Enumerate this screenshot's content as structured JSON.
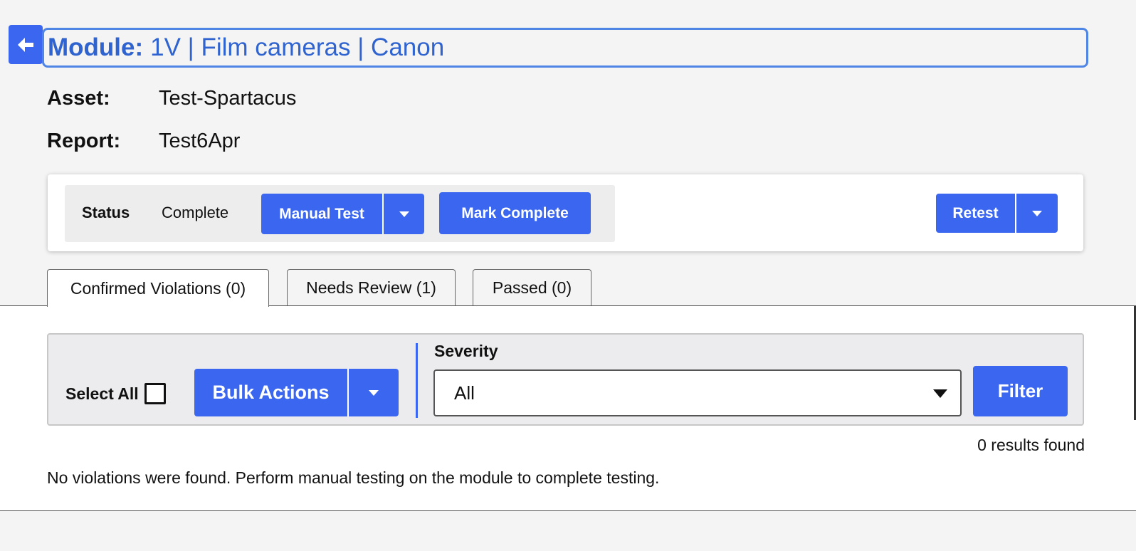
{
  "header": {
    "module_label": "Module:",
    "module_title": "1V | Film cameras | Canon"
  },
  "meta": {
    "asset_label": "Asset:",
    "asset_value": "Test-Spartacus",
    "report_label": "Report:",
    "report_value": "Test6Apr"
  },
  "status": {
    "label": "Status",
    "value": "Complete",
    "manual_test_label": "Manual Test",
    "mark_complete_label": "Mark Complete",
    "retest_label": "Retest"
  },
  "tabs": [
    {
      "label": "Confirmed Violations (0)",
      "active": true
    },
    {
      "label": "Needs Review (1)",
      "active": false
    },
    {
      "label": "Passed (0)",
      "active": false
    }
  ],
  "filter": {
    "select_all_label": "Select All",
    "bulk_actions_label": "Bulk Actions",
    "severity_label": "Severity",
    "severity_value": "All",
    "filter_button_label": "Filter"
  },
  "results": {
    "count_text": "0 results found",
    "empty_message": "No violations were found. Perform manual testing on the module to complete testing."
  },
  "colors": {
    "primary": "#3a66f0",
    "title_text": "#2f63cf",
    "title_border": "#4f86e6"
  }
}
